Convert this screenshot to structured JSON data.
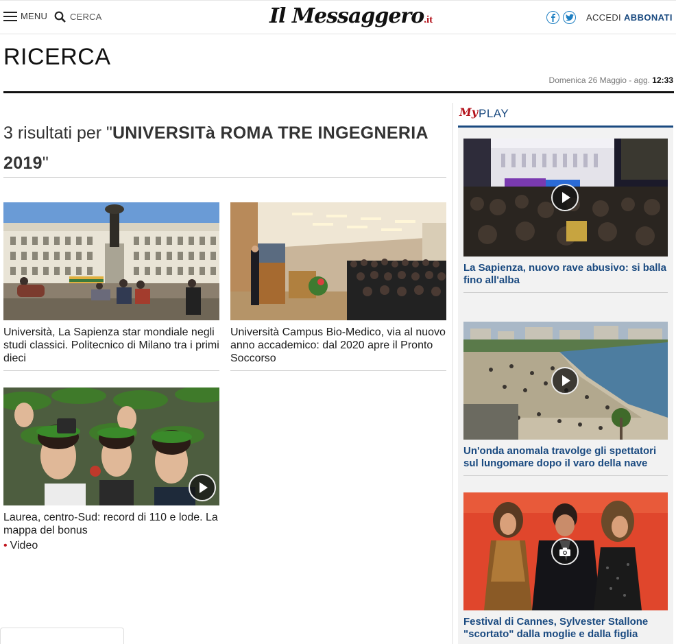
{
  "header": {
    "menu_label": "MENU",
    "search_label": "CERCA",
    "logo_text": "Il Messaggero",
    "logo_suffix": ".it",
    "login_label": "ACCEDI",
    "subscribe_label": "ABBONATI",
    "social": [
      "facebook-icon",
      "twitter-icon"
    ]
  },
  "page": {
    "title": "RICERCA",
    "date_prefix": "Domenica 26 Maggio - agg.",
    "time": "12:33"
  },
  "results": {
    "count_prefix": "3 risultati per \"",
    "query": "UNIVERSITà ROMA TRE INGEGNERIA 2019",
    "count_suffix": "\""
  },
  "articles": [
    {
      "caption": "Università, La Sapienza star mondiale negli studi classici. Politecnico di Milano tra i primi dieci",
      "image": "sapienza-campus-photo"
    },
    {
      "caption": "Università Campus Bio-Medico, via al nuovo anno accademico: dal 2020 apre il Pronto Soccorso",
      "image": "auditorium-photo"
    },
    {
      "caption": "Laurea, centro-Sud: record di 110 e lode. La mappa del bonus",
      "image": "graduates-selfie-photo",
      "tag": "Video"
    }
  ],
  "sidebar": {
    "brand_mark": "My",
    "title": "PLAY",
    "items": [
      {
        "caption": "La Sapienza, nuovo rave abusivo: si balla fino all'alba",
        "media": "video"
      },
      {
        "caption": "Un'onda anomala travolge gli spettatori sul lungomare dopo il varo della nave",
        "media": "video"
      },
      {
        "caption": "Festival di Cannes, Sylvester Stallone \"scortato\" dalla moglie e dalla figlia",
        "media": "gallery"
      }
    ]
  },
  "colors": {
    "brand_red": "#b3121b",
    "brand_blue": "#1a4a80",
    "social_blue": "#1e7fc2"
  }
}
